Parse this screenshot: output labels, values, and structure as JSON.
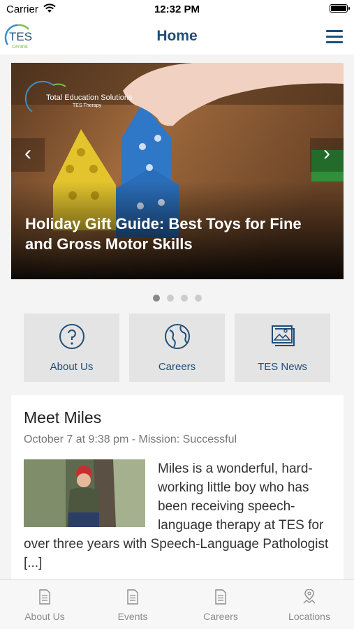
{
  "status_bar": {
    "carrier": "Carrier",
    "time": "12:32 PM"
  },
  "nav": {
    "logo_text": "TES",
    "logo_subtext": "Central",
    "title": "Home"
  },
  "carousel": {
    "brand_line1": "Total Education Solutions",
    "brand_line2": "TES Therapy",
    "caption": "Holiday Gift Guide: Best Toys for Fine and Gross Motor Skills",
    "prev_icon": "chevron-left-icon",
    "next_icon": "chevron-right-icon",
    "slide_count": 4,
    "active_slide": 1
  },
  "tiles": [
    {
      "label": "About Us",
      "icon": "question-circle-icon"
    },
    {
      "label": "Careers",
      "icon": "globe-icon"
    },
    {
      "label": "TES News",
      "icon": "news-images-icon"
    }
  ],
  "post": {
    "title": "Meet Miles",
    "meta": "October 7 at 9:38 pm - Mission: Successful",
    "excerpt": "Miles is a wonderful, hard-working little boy who has been receiving speech-language therapy at TES for over three years with Speech-Language Pathologist [...]"
  },
  "tab_bar": [
    {
      "label": "About Us",
      "icon": "document-icon"
    },
    {
      "label": "Events",
      "icon": "document-icon"
    },
    {
      "label": "Careers",
      "icon": "document-icon"
    },
    {
      "label": "Locations",
      "icon": "map-marker-icon"
    }
  ],
  "colors": {
    "brand": "#1f4e79",
    "tile_bg": "#e4e4e4",
    "tab_label": "#8c8c8c"
  }
}
